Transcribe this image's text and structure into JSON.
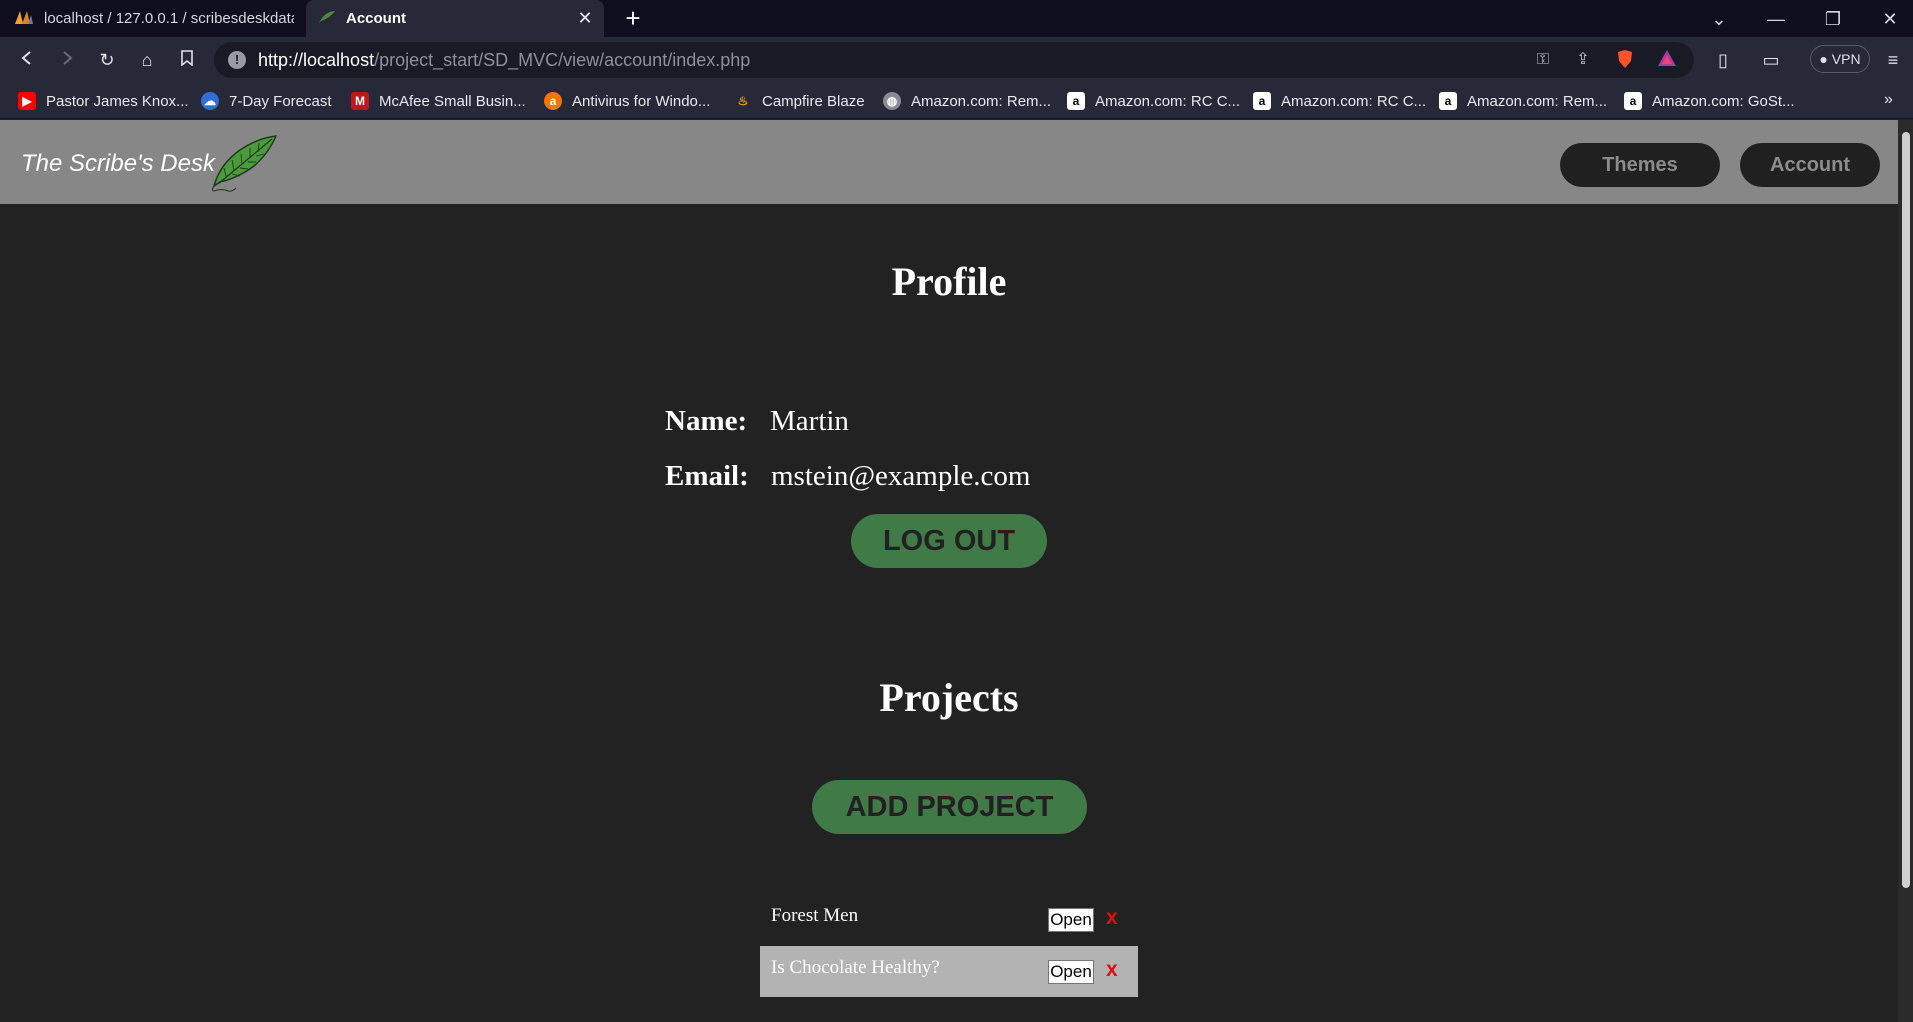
{
  "browser": {
    "tabs": [
      {
        "title": "localhost / 127.0.0.1 / scribesdeskdatab",
        "icon": "phpmyadmin-icon"
      },
      {
        "title": "Account",
        "icon": "feather-icon"
      }
    ],
    "url_host": "http://localhost",
    "url_path": "/project_start/SD_MVC/view/account/index.php",
    "vpn_label": "VPN",
    "bookmarks": [
      {
        "label": "Pastor James Knox...",
        "icon": "youtube-icon",
        "color": "#ff0000"
      },
      {
        "label": "7-Day Forecast",
        "icon": "weather-icon",
        "color": "#2f6fd6"
      },
      {
        "label": "McAfee Small Busin...",
        "icon": "mcafee-icon",
        "color": "#c01818"
      },
      {
        "label": "Antivirus for Windo...",
        "icon": "avast-icon",
        "color": "#f07800"
      },
      {
        "label": "Campfire Blaze",
        "icon": "flame-icon",
        "color": "#f0a020"
      },
      {
        "label": "Amazon.com: Rem...",
        "icon": "globe-icon",
        "color": "#8a8a96"
      },
      {
        "label": "Amazon.com: RC C...",
        "icon": "amazon-icon",
        "color": "#ffffff"
      },
      {
        "label": "Amazon.com: RC C...",
        "icon": "amazon-icon",
        "color": "#ffffff"
      },
      {
        "label": "Amazon.com: Rem...",
        "icon": "amazon-icon",
        "color": "#ffffff"
      },
      {
        "label": "Amazon.com: GoSt...",
        "icon": "amazon-icon",
        "color": "#ffffff"
      }
    ]
  },
  "site": {
    "title": "The Scribe's Desk",
    "logo_icon": "feather-quill-icon",
    "nav": {
      "themes": "Themes",
      "account": "Account"
    }
  },
  "profile": {
    "heading": "Profile",
    "name_label": "Name:",
    "name_value": "Martin",
    "email_label": "Email:",
    "email_value": "mstein@example.com",
    "logout_label": "LOG OUT"
  },
  "projects": {
    "heading": "Projects",
    "add_label": "ADD PROJECT",
    "items": [
      {
        "name": "Forest Men",
        "open_label": "Open",
        "delete_label": "x"
      },
      {
        "name": "Is Chocolate Healthy?",
        "open_label": "Open",
        "delete_label": "x"
      }
    ]
  },
  "colors": {
    "header_bg": "#878787",
    "page_bg": "#222222",
    "button_green": "#3f7a47",
    "delete_red": "#e01010"
  }
}
